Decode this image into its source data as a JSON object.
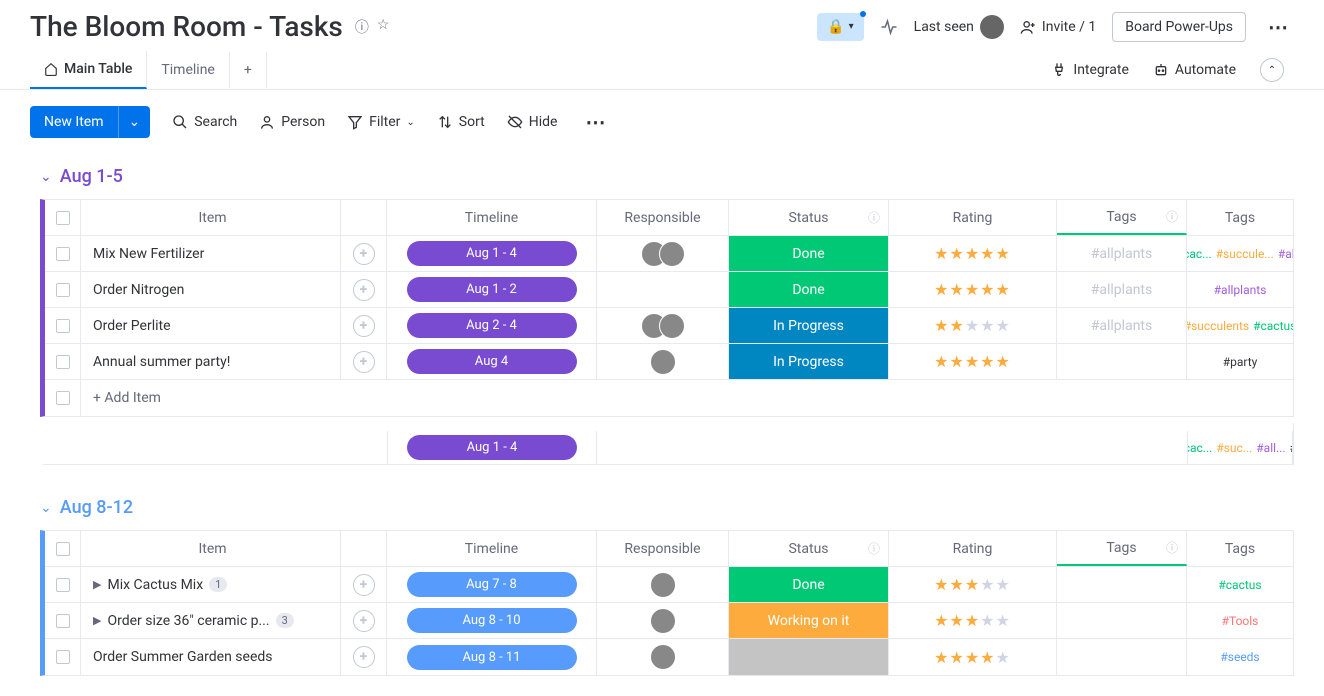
{
  "header": {
    "title": "The Bloom Room - Tasks",
    "last_seen": "Last seen",
    "invite": "Invite / 1",
    "powerups": "Board Power-Ups"
  },
  "tabs": {
    "main": "Main Table",
    "timeline": "Timeline",
    "integrate": "Integrate",
    "automate": "Automate"
  },
  "toolbar": {
    "new_item": "New Item",
    "search": "Search",
    "person": "Person",
    "filter": "Filter",
    "sort": "Sort",
    "hide": "Hide"
  },
  "columns": {
    "item": "Item",
    "timeline": "Timeline",
    "responsible": "Responsible",
    "status": "Status",
    "rating": "Rating",
    "tags1": "Tags",
    "tags2": "Tags"
  },
  "add_item": "+ Add Item",
  "groups": [
    {
      "title": "Aug 1-5",
      "summary_timeline": "Aug 1 - 4",
      "summary_tags": [
        {
          "text": "#cac...",
          "cls": "tag-cac"
        },
        {
          "text": "#suc...",
          "cls": "tag-succ"
        },
        {
          "text": "#all...",
          "cls": "tag-all"
        },
        {
          "text": "#p",
          "cls": "tag-party"
        }
      ],
      "rows": [
        {
          "item": "Mix New Fertilizer",
          "timeline": "Aug 1 - 4",
          "avatars": 2,
          "status": "Done",
          "status_cls": "status-done",
          "rating": 5,
          "tags1": "#allplants",
          "tags2": [
            {
              "text": "#cac...",
              "cls": "tag-cac"
            },
            {
              "text": "#succule...",
              "cls": "tag-succ"
            },
            {
              "text": "#allp",
              "cls": "tag-all"
            }
          ]
        },
        {
          "item": "Order Nitrogen",
          "timeline": "Aug 1 - 2",
          "avatars": 0,
          "status": "Done",
          "status_cls": "status-done",
          "rating": 5,
          "tags1": "#allplants",
          "tags2": [
            {
              "text": "#allplants",
              "cls": "tag-all"
            }
          ]
        },
        {
          "item": "Order Perlite",
          "timeline": "Aug 2 - 4",
          "avatars": 2,
          "status": "In Progress",
          "status_cls": "status-progress",
          "rating": 2,
          "tags1": "#allplants",
          "tags2": [
            {
              "text": "#succulents",
              "cls": "tag-succ"
            },
            {
              "text": "#cactus",
              "cls": "tag-cac"
            }
          ]
        },
        {
          "item": "Annual summer party!",
          "timeline": "Aug 4",
          "avatars": 1,
          "status": "In Progress",
          "status_cls": "status-progress",
          "rating": 5,
          "tags1": "",
          "tags2": [
            {
              "text": "#party",
              "cls": "tag-party"
            }
          ]
        }
      ]
    },
    {
      "title": "Aug 8-12",
      "rows": [
        {
          "item": "Mix Cactus Mix",
          "expand": true,
          "badge": "1",
          "timeline": "Aug 7 - 8",
          "avatars": 1,
          "status": "Done",
          "status_cls": "status-done",
          "rating": 3,
          "tags1": "",
          "tags2": [
            {
              "text": "#cactus",
              "cls": "tag-cactus2"
            }
          ]
        },
        {
          "item": "Order size 36\" ceramic p...",
          "expand": true,
          "badge": "3",
          "timeline": "Aug 8 - 10",
          "avatars": 1,
          "status": "Working on it",
          "status_cls": "status-working",
          "rating": 3,
          "tags1": "",
          "tags2": [
            {
              "text": "#Tools",
              "cls": "tag-tools"
            }
          ]
        },
        {
          "item": "Order Summer Garden seeds",
          "timeline": "Aug 8 - 11",
          "avatars": 1,
          "status": "",
          "status_cls": "status-blank",
          "rating": 4,
          "tags1": "",
          "tags2": [
            {
              "text": "#seeds",
              "cls": "tag-seeds"
            }
          ]
        }
      ]
    }
  ]
}
